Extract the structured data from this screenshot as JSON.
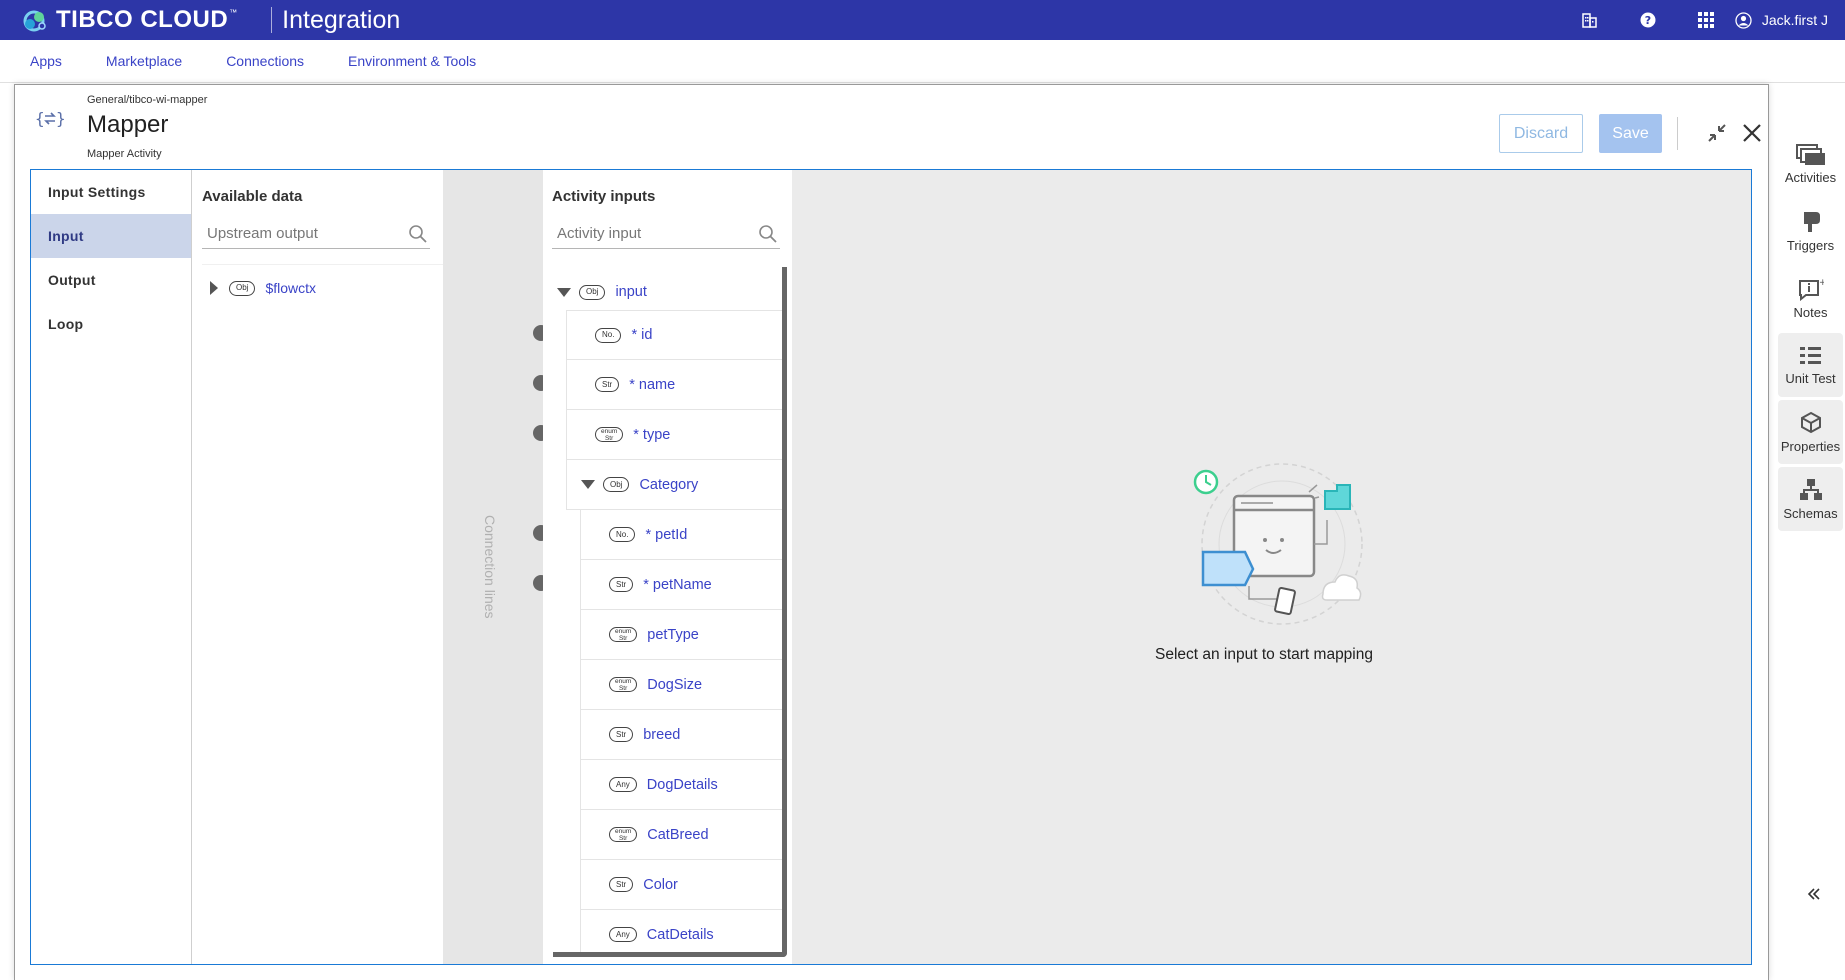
{
  "header": {
    "brand": "TIBCO CLOUD",
    "brand_tm": "™",
    "product": "Integration",
    "user": "Jack.first J",
    "icons": [
      "buildings-icon",
      "help-icon",
      "apps-grid-icon",
      "user-avatar-icon"
    ]
  },
  "nav": {
    "items": [
      "Apps",
      "Marketplace",
      "Connections",
      "Environment & Tools"
    ]
  },
  "right_rail": {
    "items": [
      {
        "label": "Activities",
        "icon": "activities-icon"
      },
      {
        "label": "Triggers",
        "icon": "triggers-icon"
      },
      {
        "label": "Notes",
        "icon": "notes-icon"
      },
      {
        "label": "Unit Test",
        "icon": "unit-test-icon"
      },
      {
        "label": "Properties",
        "icon": "properties-icon"
      },
      {
        "label": "Schemas",
        "icon": "schemas-icon"
      }
    ],
    "collapse_symbol": "«"
  },
  "modal": {
    "breadcrumb": "General/tibco-wi-mapper",
    "title": "Mapper",
    "subtitle": "Mapper Activity",
    "icon_text": "{⇄}",
    "discard_label": "Discard",
    "save_label": "Save"
  },
  "settings": {
    "items": [
      "Input Settings",
      "Input",
      "Output",
      "Loop"
    ],
    "active": "Input"
  },
  "available": {
    "title": "Available data",
    "search_placeholder": "Upstream output",
    "tree": [
      {
        "badge": "Obj",
        "label": "$flowctx"
      }
    ]
  },
  "connector": {
    "label": "Connection lines"
  },
  "activity_inputs": {
    "title": "Activity inputs",
    "search_placeholder": "Activity input",
    "rows": [
      {
        "badge": "Obj",
        "badge_top": "",
        "label": "input"
      },
      {
        "badge": "No.",
        "badge_top": "",
        "label": "* id"
      },
      {
        "badge": "Str",
        "badge_top": "",
        "label": "* name"
      },
      {
        "badge": "Str",
        "badge_top": "enum",
        "label": "* type"
      },
      {
        "badge": "Obj",
        "badge_top": "",
        "label": "Category"
      },
      {
        "badge": "No.",
        "badge_top": "",
        "label": "* petId"
      },
      {
        "badge": "Str",
        "badge_top": "",
        "label": "* petName"
      },
      {
        "badge": "Str",
        "badge_top": "enum",
        "label": "petType"
      },
      {
        "badge": "Str",
        "badge_top": "enum",
        "label": "DogSize"
      },
      {
        "badge": "Str",
        "badge_top": "",
        "label": "breed"
      },
      {
        "badge": "Any",
        "badge_top": "",
        "label": "DogDetails"
      },
      {
        "badge": "Str",
        "badge_top": "enum",
        "label": "CatBreed"
      },
      {
        "badge": "Str",
        "badge_top": "",
        "label": "Color"
      },
      {
        "badge": "Any",
        "badge_top": "",
        "label": "CatDetails"
      }
    ]
  },
  "mapping": {
    "empty_message": "Select an input to start mapping"
  },
  "colors": {
    "topbar": "#2d36a7",
    "link": "#3a43c7",
    "active_setting": "#cbd5ea",
    "frame_border": "#1a7ad6",
    "save_disabled": "#a4c3ef"
  }
}
